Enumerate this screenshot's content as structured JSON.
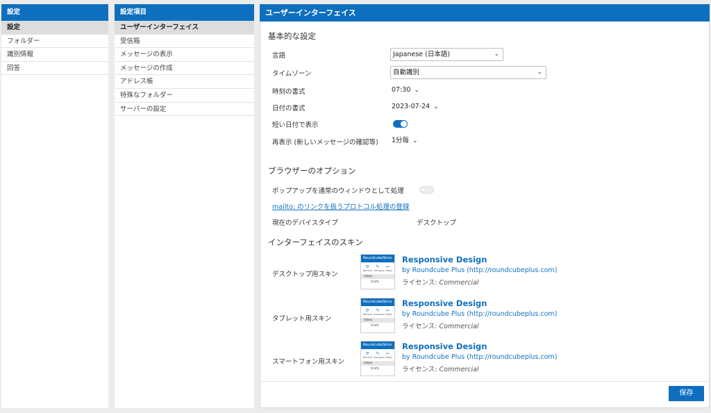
{
  "settings_panel": {
    "header": "設定",
    "items": [
      {
        "label": "設定",
        "active": true
      },
      {
        "label": "フォルダー",
        "active": false
      },
      {
        "label": "識別情報",
        "active": false
      },
      {
        "label": "回答",
        "active": false
      }
    ]
  },
  "sections_panel": {
    "header": "設定項目",
    "items": [
      {
        "label": "ユーザーインターフェイス",
        "active": true
      },
      {
        "label": "受信箱",
        "active": false
      },
      {
        "label": "メッセージの表示",
        "active": false
      },
      {
        "label": "メッセージの作成",
        "active": false
      },
      {
        "label": "アドレス帳",
        "active": false
      },
      {
        "label": "特殊なフォルダー",
        "active": false
      },
      {
        "label": "サーバーの設定",
        "active": false
      }
    ]
  },
  "main": {
    "header": "ユーザーインターフェイス",
    "basic": {
      "title": "基本的な設定",
      "language": {
        "label": "言語",
        "value": "Japanese (日本語)"
      },
      "timezone": {
        "label": "タイムゾーン",
        "value": "自動識別"
      },
      "time_format": {
        "label": "時刻の書式",
        "value": "07:30"
      },
      "date_format": {
        "label": "日付の書式",
        "value": "2023-07-24"
      },
      "pretty_date": {
        "label": "短い日付で表示",
        "enabled": true
      },
      "refresh": {
        "label": "再表示 (新しいメッセージの確認等)",
        "value": "1分毎"
      }
    },
    "browser": {
      "title": "ブラウザーのオプション",
      "popup": {
        "label": "ポップアップを通常のウィンドウとして処理",
        "enabled": false
      },
      "mailto_link": "mailto: のリンクを扱うプロトコル処理の登録",
      "device_type": {
        "label": "現在のデバイスタイプ",
        "value": "デスクトップ"
      }
    },
    "skins": {
      "title": "インターフェイスのスキン",
      "items": [
        {
          "label": "デスクトップ用スキン",
          "name": "Responsive Design",
          "author": "by Roundcube Plus (http://roundcubeplus.com)",
          "license_label": "ライセンス:",
          "license": "Commercial"
        },
        {
          "label": "タブレット用スキン",
          "name": "Responsive Design",
          "author": "by Roundcube Plus (http://roundcubeplus.com)",
          "license_label": "ライセンス:",
          "license": "Commercial"
        },
        {
          "label": "スマートフォン用スキン",
          "name": "Responsive Design",
          "author": "by Roundcube Plus (http://roundcubeplus.com)",
          "license_label": "ライセンス:",
          "license": "Commercial"
        }
      ],
      "thumb": {
        "bar": "RoundcubeSkins",
        "icon_labels": [
          "Refresh",
          "Compose",
          "Reply"
        ],
        "inbox": "Inbox",
        "drafts": "Drafts"
      }
    },
    "save_label": "保存"
  },
  "colors": {
    "accent": "#0f6fbf",
    "background": "#ececec"
  },
  "icons": [
    "chevron-down-icon",
    "toggle-switch",
    "refresh-icon",
    "compose-icon"
  ]
}
